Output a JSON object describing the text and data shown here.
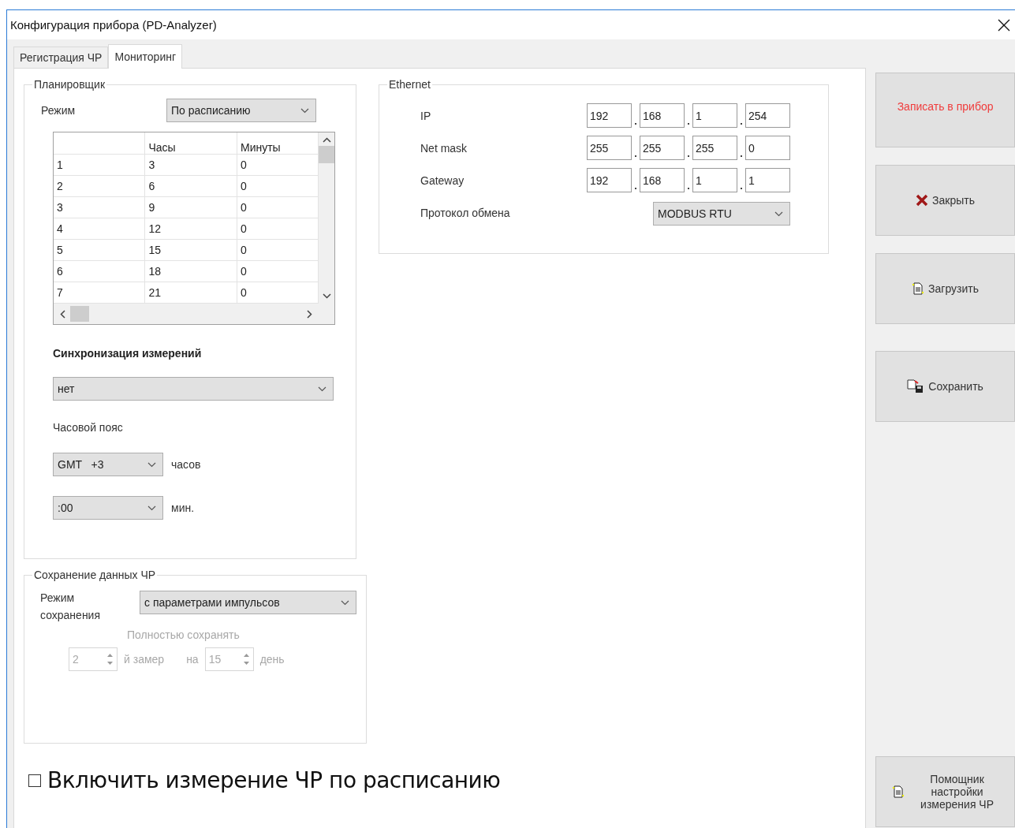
{
  "window": {
    "title": "Конфигурация прибора (PD-Analyzer)"
  },
  "tabs": [
    {
      "label": "Регистрация ЧР",
      "selected": false
    },
    {
      "label": "Мониторинг",
      "selected": true
    }
  ],
  "scheduler": {
    "title": "Планировщик",
    "mode_label": "Режим",
    "mode_value": "По расписанию",
    "table": {
      "columns": [
        "",
        "Часы",
        "Минуты"
      ],
      "rows": [
        [
          "1",
          "3",
          "0"
        ],
        [
          "2",
          "6",
          "0"
        ],
        [
          "3",
          "9",
          "0"
        ],
        [
          "4",
          "12",
          "0"
        ],
        [
          "5",
          "15",
          "0"
        ],
        [
          "6",
          "18",
          "0"
        ],
        [
          "7",
          "21",
          "0"
        ]
      ]
    },
    "sync_title": "Синхронизация измерений",
    "sync_value": "нет",
    "timezone_label": "Часовой пояс",
    "hours_value": "GMT   +3",
    "hours_unit": "часов",
    "minutes_value": ":00",
    "minutes_unit": "мин."
  },
  "data_saving": {
    "title": "Сохранение данных ЧР",
    "mode_label": "Режим сохранения",
    "mode_value": "с параметрами импульсов",
    "full_save": {
      "disabled": true,
      "label": "Полностью сохранять",
      "measurement": "2",
      "measurement_unit": "й замер",
      "on_label": "на",
      "day": "15",
      "day_unit": "день"
    }
  },
  "ethernet": {
    "title": "Ethernet",
    "rows": [
      {
        "label": "IP",
        "octets": [
          "192",
          "168",
          "1",
          "254"
        ]
      },
      {
        "label": "Net mask",
        "octets": [
          "255",
          "255",
          "255",
          "0"
        ]
      },
      {
        "label": "Gateway",
        "octets": [
          "192",
          "168",
          "1",
          "1"
        ]
      }
    ],
    "protocol_label": "Протокол обмена",
    "protocol_value": "MODBUS RTU"
  },
  "schedule_checkbox": {
    "label": "Включить измерение ЧР по расписанию",
    "checked": false
  },
  "buttons": [
    {
      "label": "Записать в прибор",
      "kind": "write"
    },
    {
      "label": "Закрыть",
      "kind": "close"
    },
    {
      "label": "Загрузить",
      "kind": "load"
    },
    {
      "label": "Сохранить",
      "kind": "save"
    },
    {
      "label": "Помощник настройки измерения ЧР",
      "kind": "wizard"
    }
  ]
}
